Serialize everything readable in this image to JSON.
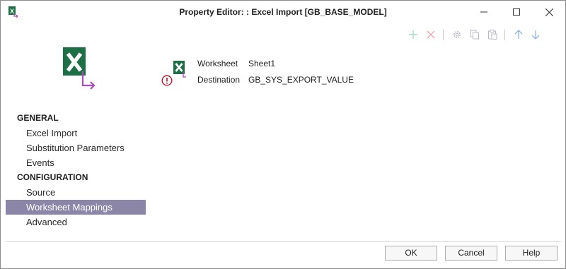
{
  "window": {
    "title": "Property Editor: : Excel Import [GB_BASE_MODEL]",
    "icon": "excel-import-icon",
    "controls": [
      "minimize-icon",
      "maximize-icon",
      "close-icon"
    ]
  },
  "toolbar": {
    "buttons": [
      "add-icon",
      "delete-icon",
      "settings-icon",
      "copy-icon",
      "paste-icon",
      "move-up-icon",
      "move-down-icon"
    ],
    "colors": {
      "add": "#a9d9c4",
      "delete": "#f0a8b0",
      "disabled": "#b8b8c8",
      "arrows": "#8fb8e0"
    }
  },
  "summary": {
    "worksheet_label": "Worksheet",
    "worksheet_value": "Sheet1",
    "destination_label": "Destination",
    "destination_value": "GB_SYS_EXPORT_VALUE",
    "warning_icon": "error-circle-icon"
  },
  "nav": {
    "general_header": "GENERAL",
    "general_items": [
      "Excel Import",
      "Substitution Parameters",
      "Events"
    ],
    "config_header": "CONFIGURATION",
    "config_items": [
      "Source",
      "Worksheet Mappings",
      "Advanced"
    ],
    "selected": "Worksheet Mappings",
    "selected_color": "#8b86a8"
  },
  "footer": {
    "ok_label": "OK",
    "cancel_label": "Cancel",
    "help_label": "Help"
  },
  "colors": {
    "excel_green": "#1d7045",
    "arrow_purple": "#a64fb5",
    "warning_red": "#d0021b"
  }
}
